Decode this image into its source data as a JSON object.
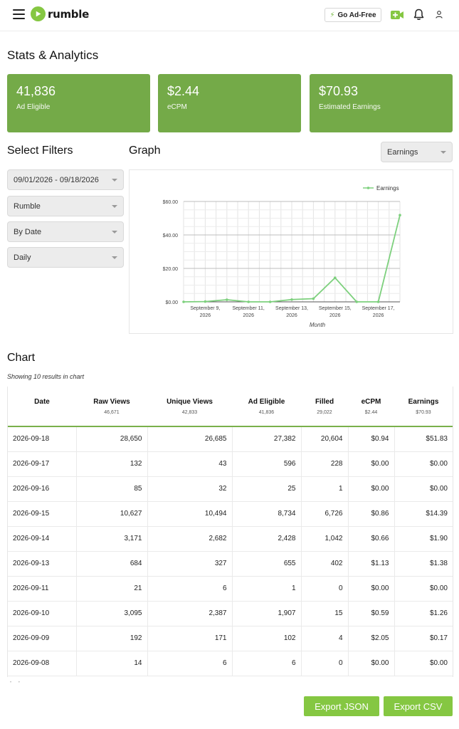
{
  "header": {
    "logo_text": "rumble",
    "go_adfree_label": "Go Ad-Free"
  },
  "page_title": "Stats & Analytics",
  "stats": [
    {
      "value": "41,836",
      "label": "Ad Eligible"
    },
    {
      "value": "$2.44",
      "label": "eCPM"
    },
    {
      "value": "$70.93",
      "label": "Estimated Earnings"
    }
  ],
  "filters": {
    "title": "Select Filters",
    "date_range": "09/01/2026 - 09/18/2026",
    "platform": "Rumble",
    "group_by": "By Date",
    "interval": "Daily"
  },
  "graph": {
    "title": "Graph",
    "metric_select": "Earnings"
  },
  "chart_data": {
    "type": "line",
    "x": [
      "September 8, 2026",
      "September 9, 2026",
      "September 10, 2026",
      "September 11, 2026",
      "September 12, 2026",
      "September 13, 2026",
      "September 14, 2026",
      "September 15, 2026",
      "September 16, 2026",
      "September 17, 2026",
      "September 18, 2026"
    ],
    "x_tick_labels": [
      [
        "September 9,",
        "2026"
      ],
      [
        "September 11,",
        "2026"
      ],
      [
        "September 13,",
        "2026"
      ],
      [
        "September 15,",
        "2026"
      ],
      [
        "September 17,",
        "2026"
      ]
    ],
    "series": [
      {
        "name": "Earnings",
        "values": [
          0.0,
          0.17,
          1.26,
          0.0,
          0.0,
          1.38,
          1.9,
          14.39,
          0.0,
          0.0,
          51.83
        ],
        "color": "#7dd07d"
      }
    ],
    "y_ticks": [
      "$0.00",
      "$20.00",
      "$40.00",
      "$60.00"
    ],
    "ylim": [
      0,
      60
    ],
    "xlabel": "Month",
    "legend_position": "top-right",
    "grid": true
  },
  "chart": {
    "title": "Chart",
    "note": "Showing 10 results in chart",
    "columns": [
      {
        "label": "Date",
        "total": ""
      },
      {
        "label": "Raw Views",
        "total": "46,671"
      },
      {
        "label": "Unique Views",
        "total": "42,833"
      },
      {
        "label": "Ad Eligible",
        "total": "41,836"
      },
      {
        "label": "Filled",
        "total": "29,022"
      },
      {
        "label": "eCPM",
        "total": "$2.44"
      },
      {
        "label": "Earnings",
        "total": "$70.93"
      }
    ],
    "rows": [
      [
        "2026-09-18",
        "28,650",
        "26,685",
        "27,382",
        "20,604",
        "$0.94",
        "$51.83"
      ],
      [
        "2026-09-17",
        "132",
        "43",
        "596",
        "228",
        "$0.00",
        "$0.00"
      ],
      [
        "2026-09-16",
        "85",
        "32",
        "25",
        "1",
        "$0.00",
        "$0.00"
      ],
      [
        "2026-09-15",
        "10,627",
        "10,494",
        "8,734",
        "6,726",
        "$0.86",
        "$14.39"
      ],
      [
        "2026-09-14",
        "3,171",
        "2,682",
        "2,428",
        "1,042",
        "$0.66",
        "$1.90"
      ],
      [
        "2026-09-13",
        "684",
        "327",
        "655",
        "402",
        "$1.13",
        "$1.38"
      ],
      [
        "2026-09-11",
        "21",
        "6",
        "1",
        "0",
        "$0.00",
        "$0.00"
      ],
      [
        "2026-09-10",
        "3,095",
        "2,387",
        "1,907",
        "15",
        "$0.59",
        "$1.26"
      ],
      [
        "2026-09-09",
        "192",
        "171",
        "102",
        "4",
        "$2.05",
        "$0.17"
      ],
      [
        "2026-09-08",
        "14",
        "6",
        "6",
        "0",
        "$0.00",
        "$0.00"
      ]
    ]
  },
  "export": {
    "json_label": "Export JSON",
    "csv_label": "Export CSV"
  },
  "colors": {
    "brand_green": "#85c742",
    "card_green": "#74aa48",
    "line_green": "#7dd07d"
  }
}
